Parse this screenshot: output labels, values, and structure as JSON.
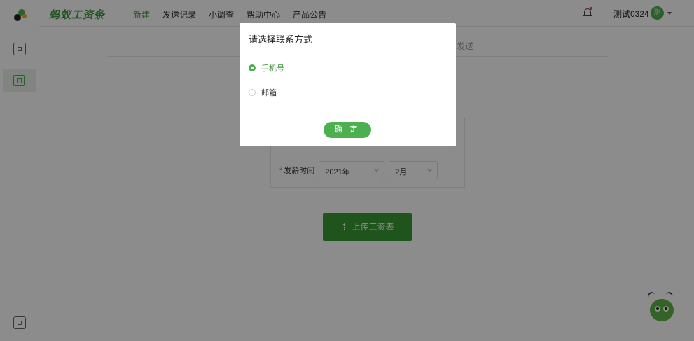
{
  "app": {
    "brand": "蚂蚁工资条"
  },
  "nav": {
    "items": [
      {
        "label": "新建",
        "active": true
      },
      {
        "label": "发送记录",
        "active": false
      },
      {
        "label": "小调查",
        "active": false
      },
      {
        "label": "帮助中心",
        "active": false
      },
      {
        "label": "产品公告",
        "active": false
      }
    ]
  },
  "header": {
    "username": "测试0324",
    "avatar_char": "测"
  },
  "steps": {
    "peek_label": "发送"
  },
  "form": {
    "date_label": "发薪时间",
    "year_value": "2021年",
    "month_value": "2月"
  },
  "upload": {
    "label": "上传工资表",
    "icon": "upload-icon"
  },
  "modal": {
    "title": "请选择联系方式",
    "options": [
      {
        "label": "手机号",
        "checked": true
      },
      {
        "label": "邮箱",
        "checked": false
      }
    ],
    "confirm_label": "确 定"
  },
  "colors": {
    "accent": "#4caf50",
    "brand": "#3d9a3a",
    "required": "#ee4444"
  }
}
